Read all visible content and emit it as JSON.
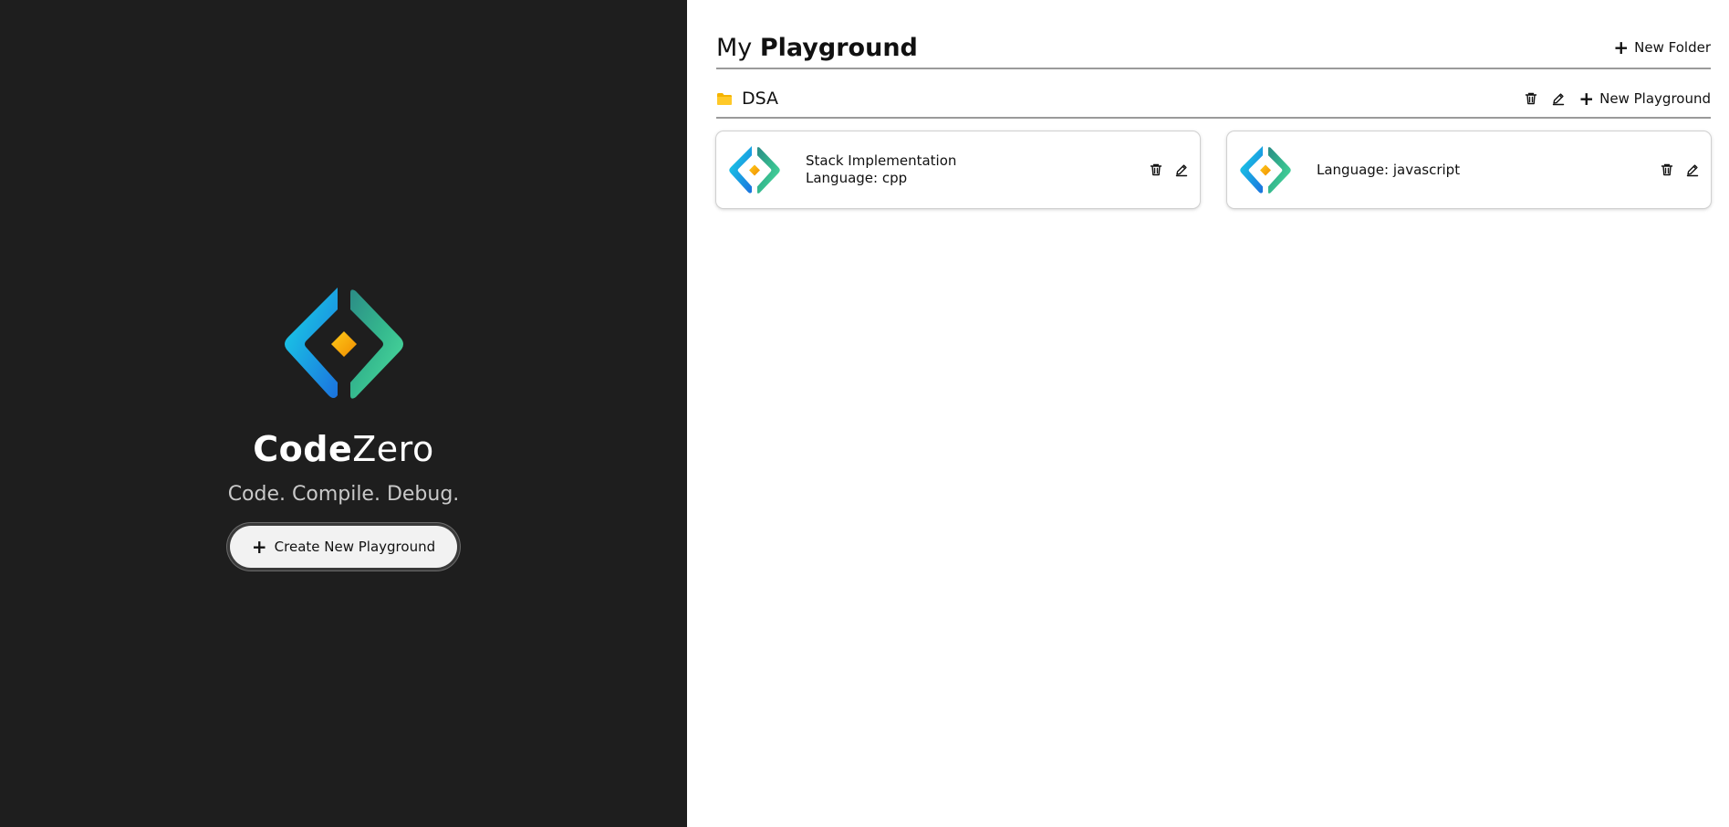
{
  "brand": {
    "name_bold": "Code",
    "name_regular": "Zero",
    "tagline": "Code. Compile. Debug."
  },
  "left": {
    "create_button_label": "Create New Playground"
  },
  "header": {
    "title_prefix": "My",
    "title_bold": "Playground",
    "new_folder_label": "New Folder"
  },
  "folder": {
    "name": "DSA",
    "new_playground_label": "New Playground"
  },
  "cards": [
    {
      "title": "Stack Implementation",
      "language": "Language: cpp"
    },
    {
      "title": "",
      "language": "Language: javascript"
    }
  ],
  "icons": {
    "logo": "code-zero-logo",
    "folder": "folder-icon",
    "delete": "trash-icon",
    "edit": "pencil-icon",
    "add": "plus-icon"
  },
  "colors": {
    "sidebar_bg": "#1e1e1e",
    "folder": "#f5b400",
    "logo_cyan": "#19c9e0",
    "logo_blue": "#1b7fe0",
    "logo_green": "#3ecf8e",
    "logo_diamond": "#f7a400"
  }
}
